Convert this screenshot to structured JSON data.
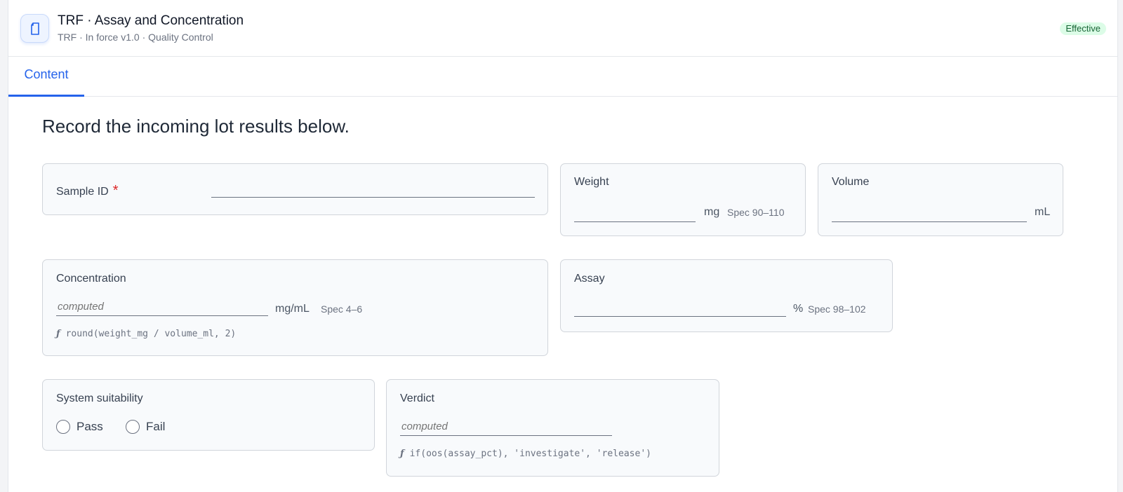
{
  "header": {
    "title": "TRF · Assay and Concentration",
    "subtitle": "TRF · In force v1.0 · Quality Control",
    "status": "Effective",
    "icon": "document-icon"
  },
  "tabs": [
    {
      "label": "Content",
      "active": true
    }
  ],
  "intro": "Record the incoming lot results below.",
  "fields": {
    "sample_id": {
      "label": "Sample ID",
      "required_marker": "*",
      "value": ""
    },
    "weight": {
      "label": "Weight",
      "unit": "mg",
      "spec": "Spec 90–110",
      "value": ""
    },
    "volume": {
      "label": "Volume",
      "unit": "mL",
      "value": ""
    },
    "concentration": {
      "label": "Concentration",
      "placeholder": "computed",
      "unit": "mg/mL",
      "spec": "Spec 4–6",
      "formula_symbol": "ƒ",
      "formula": "round(weight_mg / volume_ml, 2)"
    },
    "assay": {
      "label": "Assay",
      "unit": "%",
      "spec": "Spec 98–102",
      "value": ""
    },
    "system_suitability": {
      "label": "System suitability",
      "options": [
        "Pass",
        "Fail"
      ]
    },
    "verdict": {
      "label": "Verdict",
      "placeholder": "computed",
      "formula_symbol": "ƒ",
      "formula": "if(oos(assay_pct), 'investigate', 'release')"
    }
  },
  "colors": {
    "accent": "#2563eb",
    "status_bg": "#dcfce7",
    "status_text": "#166534",
    "required": "#dc2626"
  }
}
